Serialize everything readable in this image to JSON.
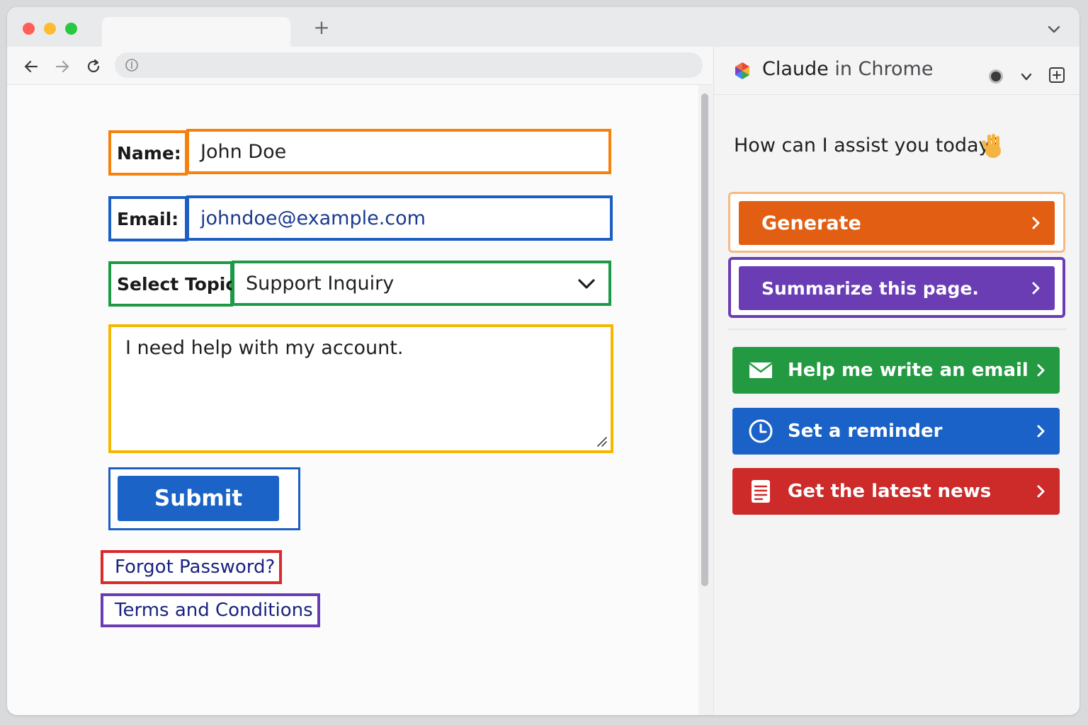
{
  "browser": {
    "tab_title": "",
    "new_tab_glyph": "+",
    "address": ""
  },
  "form": {
    "name_label": "Name:",
    "name_value": "John Doe",
    "email_label": "Email:",
    "email_value": "johndoe@example.com",
    "topic_label": "Select Topic:",
    "topic_value": "Support Inquiry",
    "message_value": "I need help with my account.",
    "submit_label": "Submit",
    "forgot_link": "Forgot Password?",
    "terms_link": "Terms and Conditions"
  },
  "panel": {
    "title_bold": "Claude",
    "title_rest": " in Chrome",
    "greeting": "How can I assist you today?",
    "buttons": [
      {
        "label": "Generate",
        "color": "#e15e13"
      },
      {
        "label": "Summarize this page.",
        "color": "#6a3db5"
      }
    ],
    "actions": [
      {
        "label": "Help me write an email",
        "icon": "envelope-icon",
        "color": "#239a42"
      },
      {
        "label": "Set a reminder",
        "icon": "clock-icon",
        "color": "#1a62c8"
      },
      {
        "label": "Get the latest news",
        "icon": "document-icon",
        "color": "#cd2a2a"
      }
    ]
  }
}
